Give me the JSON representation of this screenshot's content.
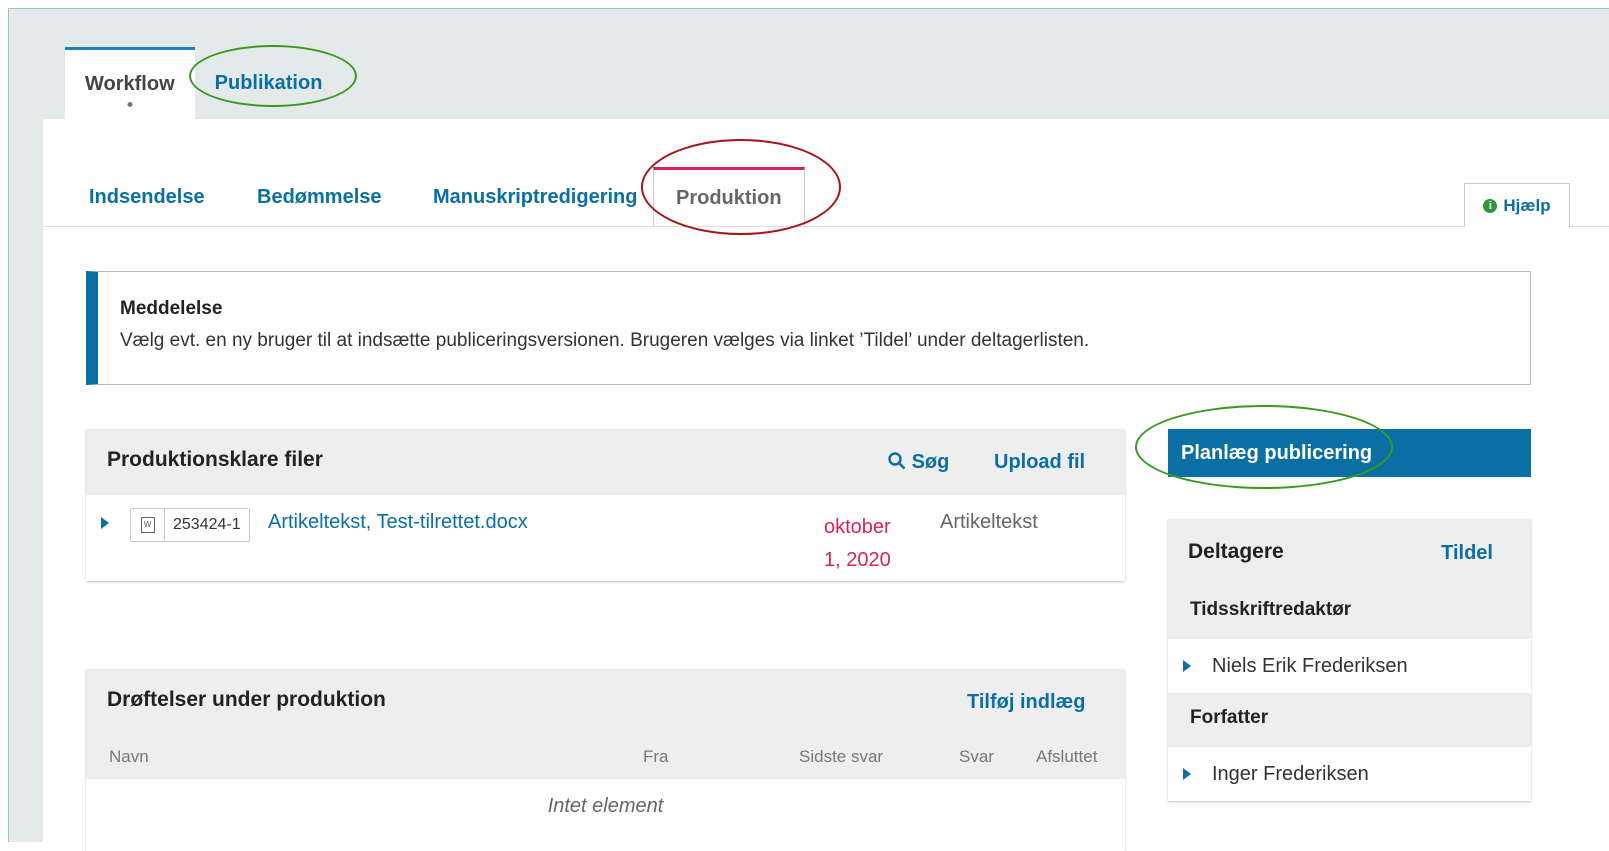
{
  "top_tabs": {
    "workflow": "Workflow",
    "publication": "Publikation"
  },
  "stage_tabs": {
    "submission": "Indsendelse",
    "review": "Bedømmelse",
    "copyediting": "Manuskriptredigering",
    "production": "Produktion"
  },
  "help": {
    "label": "Hjælp"
  },
  "notice": {
    "title": "Meddelelse",
    "text": "Vælg evt. en ny bruger til at indsætte publiceringsversionen. Brugeren vælges via linket ’Tildel’ under deltagerlisten."
  },
  "files": {
    "title": "Produktionsklare filer",
    "search_label": "Søg",
    "upload_label": "Upload fil",
    "rows": [
      {
        "id": "253424-1",
        "name": "Artikeltekst, Test-tilrettet.docx",
        "date": "oktober 1, 2020",
        "type": "Artikeltekst"
      }
    ]
  },
  "discussions": {
    "title": "Drøftelser under produktion",
    "add_label": "Tilføj indlæg",
    "columns": [
      "Navn",
      "Fra",
      "Sidste svar",
      "Svar",
      "Afsluttet"
    ],
    "empty": "Intet element"
  },
  "schedule_button": "Planlæg publicering",
  "participants": {
    "title": "Deltagere",
    "assign_label": "Tildel",
    "groups": [
      {
        "role": "Tidsskriftredaktør",
        "people": [
          "Niels Erik Frederiksen"
        ]
      },
      {
        "role": "Forfatter",
        "people": [
          "Inger Frederiksen"
        ]
      }
    ]
  },
  "colors": {
    "link": "#0a6fa3",
    "accent": "#d6225f",
    "annotation_green": "#3a9a1e",
    "annotation_red": "#a31616"
  }
}
